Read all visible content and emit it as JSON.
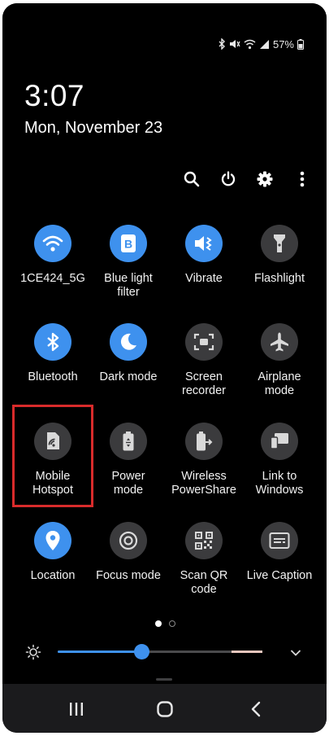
{
  "status_bar": {
    "battery_text": "57%",
    "icons": [
      "bluetooth-icon",
      "mute-icon",
      "wifi-icon",
      "signal-icon",
      "battery-icon"
    ]
  },
  "header": {
    "time": "3:07",
    "date": "Mon, November 23"
  },
  "top_actions": [
    "search-icon",
    "power-icon",
    "gear-icon",
    "more-vert-icon"
  ],
  "tiles": [
    {
      "label": "1CE424_5G",
      "icon": "wifi-icon",
      "state": "on"
    },
    {
      "label": "Blue light\nfilter",
      "icon": "blue-light-filter-icon",
      "state": "on"
    },
    {
      "label": "Vibrate",
      "icon": "vibrate-icon",
      "state": "on"
    },
    {
      "label": "Flashlight",
      "icon": "flashlight-icon",
      "state": "off"
    },
    {
      "label": "Bluetooth",
      "icon": "bluetooth-icon",
      "state": "on"
    },
    {
      "label": "Dark mode",
      "icon": "moon-icon",
      "state": "on"
    },
    {
      "label": "Screen\nrecorder",
      "icon": "screen-recorder-icon",
      "state": "off"
    },
    {
      "label": "Airplane\nmode",
      "icon": "airplane-icon",
      "state": "off"
    },
    {
      "label": "Mobile\nHotspot",
      "icon": "hotspot-icon",
      "state": "off"
    },
    {
      "label": "Power\nmode",
      "icon": "power-mode-icon",
      "state": "off"
    },
    {
      "label": "Wireless\nPowerShare",
      "icon": "wireless-powershare-icon",
      "state": "off"
    },
    {
      "label": "Link to\nWindows",
      "icon": "link-to-windows-icon",
      "state": "off"
    },
    {
      "label": "Location",
      "icon": "location-icon",
      "state": "on"
    },
    {
      "label": "Focus mode",
      "icon": "focus-mode-icon",
      "state": "off"
    },
    {
      "label": "Scan QR\ncode",
      "icon": "qr-code-icon",
      "state": "off"
    },
    {
      "label": "Live Caption",
      "icon": "live-caption-icon",
      "state": "off"
    }
  ],
  "pager": {
    "pages": 2,
    "current": 1
  },
  "brightness": {
    "level": 0.41,
    "icon": "brightness-icon",
    "expand_icon": "chevron-down-icon"
  },
  "nav_bar": [
    "recent-apps-icon",
    "home-icon",
    "back-icon"
  ],
  "colors": {
    "accent": "#3e91ee",
    "tile_off": "#3b3b3d",
    "highlight": "#d92b2b"
  }
}
